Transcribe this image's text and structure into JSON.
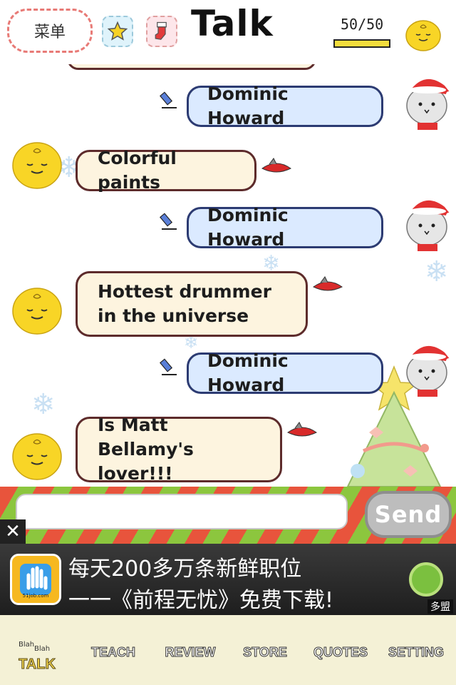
{
  "header": {
    "menu_label": "菜单",
    "title": "Talk",
    "counter": "50/50",
    "energy_fraction": 1.0,
    "icons": [
      "star-icon",
      "stocking-icon",
      "chick-avatar-icon"
    ]
  },
  "messages": [
    {
      "side": "out",
      "text": "Dominic Howard"
    },
    {
      "side": "in",
      "text": "Colorful paints"
    },
    {
      "side": "out",
      "text": "Dominic Howard"
    },
    {
      "side": "in",
      "text": "Hottest drummer in the universe"
    },
    {
      "side": "out",
      "text": "Dominic Howard"
    },
    {
      "side": "in",
      "text": "Is Matt Bellamy's lover!!!"
    }
  ],
  "input": {
    "value": "",
    "placeholder": "",
    "send_label": "Send"
  },
  "ad": {
    "close_label": "✕",
    "line1": "每天200多万条新鲜职位",
    "line2": "一一《前程无忧》免费下载!",
    "logo_text": "51job.com",
    "brand": "多盟"
  },
  "tabs": {
    "talk": "TALK",
    "blah1": "Blah",
    "blah2": "Blah",
    "teach": "TEACH",
    "review": "REVIEW",
    "store": "STORE",
    "quotes": "QUOTES",
    "setting": "SETTING"
  },
  "colors": {
    "bubble_in": "#fdf4df",
    "bubble_out": "#dbeaff",
    "stripe_red": "#e8543c",
    "stripe_green": "#8cc63e",
    "tabbar_bg": "#f4f1d6"
  }
}
